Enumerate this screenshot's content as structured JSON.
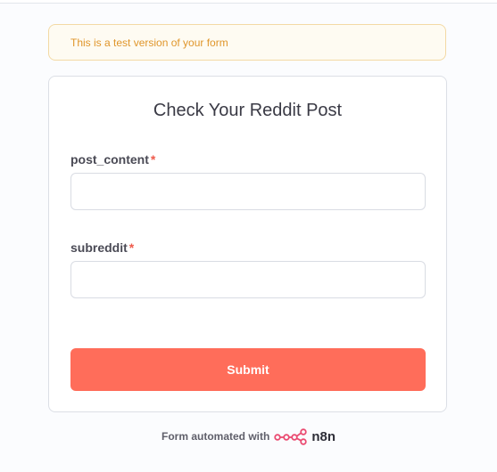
{
  "banner": {
    "text": "This is a test version of your form"
  },
  "form": {
    "title": "Check Your Reddit Post",
    "fields": [
      {
        "label": "post_content",
        "required_marker": "*",
        "value": "",
        "placeholder": ""
      },
      {
        "label": "subreddit",
        "required_marker": "*",
        "value": "",
        "placeholder": ""
      }
    ],
    "submit_label": "Submit"
  },
  "footer": {
    "text": "Form automated with",
    "brand": "n8n",
    "logo_icon": "n8n-logo-icon"
  },
  "colors": {
    "accent": "#ff6d5a",
    "required": "#ef5b4c",
    "banner_text": "#e0962b",
    "banner_bg": "#fefbf2",
    "banner_border": "#f3d9a4"
  }
}
